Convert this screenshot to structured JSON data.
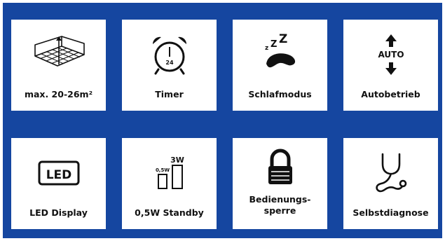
{
  "colors": {
    "panel": "#1546a0",
    "tile": "#ffffff",
    "ink": "#111111"
  },
  "features": [
    {
      "icon": "room-area-icon",
      "label": "max. 20-26m²"
    },
    {
      "icon": "alarm-clock-icon",
      "label": "Timer",
      "icon_text": "24"
    },
    {
      "icon": "sleep-mode-icon",
      "label": "Schlafmodus"
    },
    {
      "icon": "auto-mode-icon",
      "label": "Autobetrieb",
      "icon_text": "AUTO"
    },
    {
      "icon": "led-display-icon",
      "label": "LED Display",
      "icon_text": "LED"
    },
    {
      "icon": "standby-power-icon",
      "label": "0,5W Standby",
      "icon_text_small": "0,5W",
      "icon_text_large": "3W"
    },
    {
      "icon": "padlock-icon",
      "label_line1": "Bedienungs-",
      "label_line2": "sperre"
    },
    {
      "icon": "stethoscope-icon",
      "label": "Selbstdiagnose"
    }
  ]
}
